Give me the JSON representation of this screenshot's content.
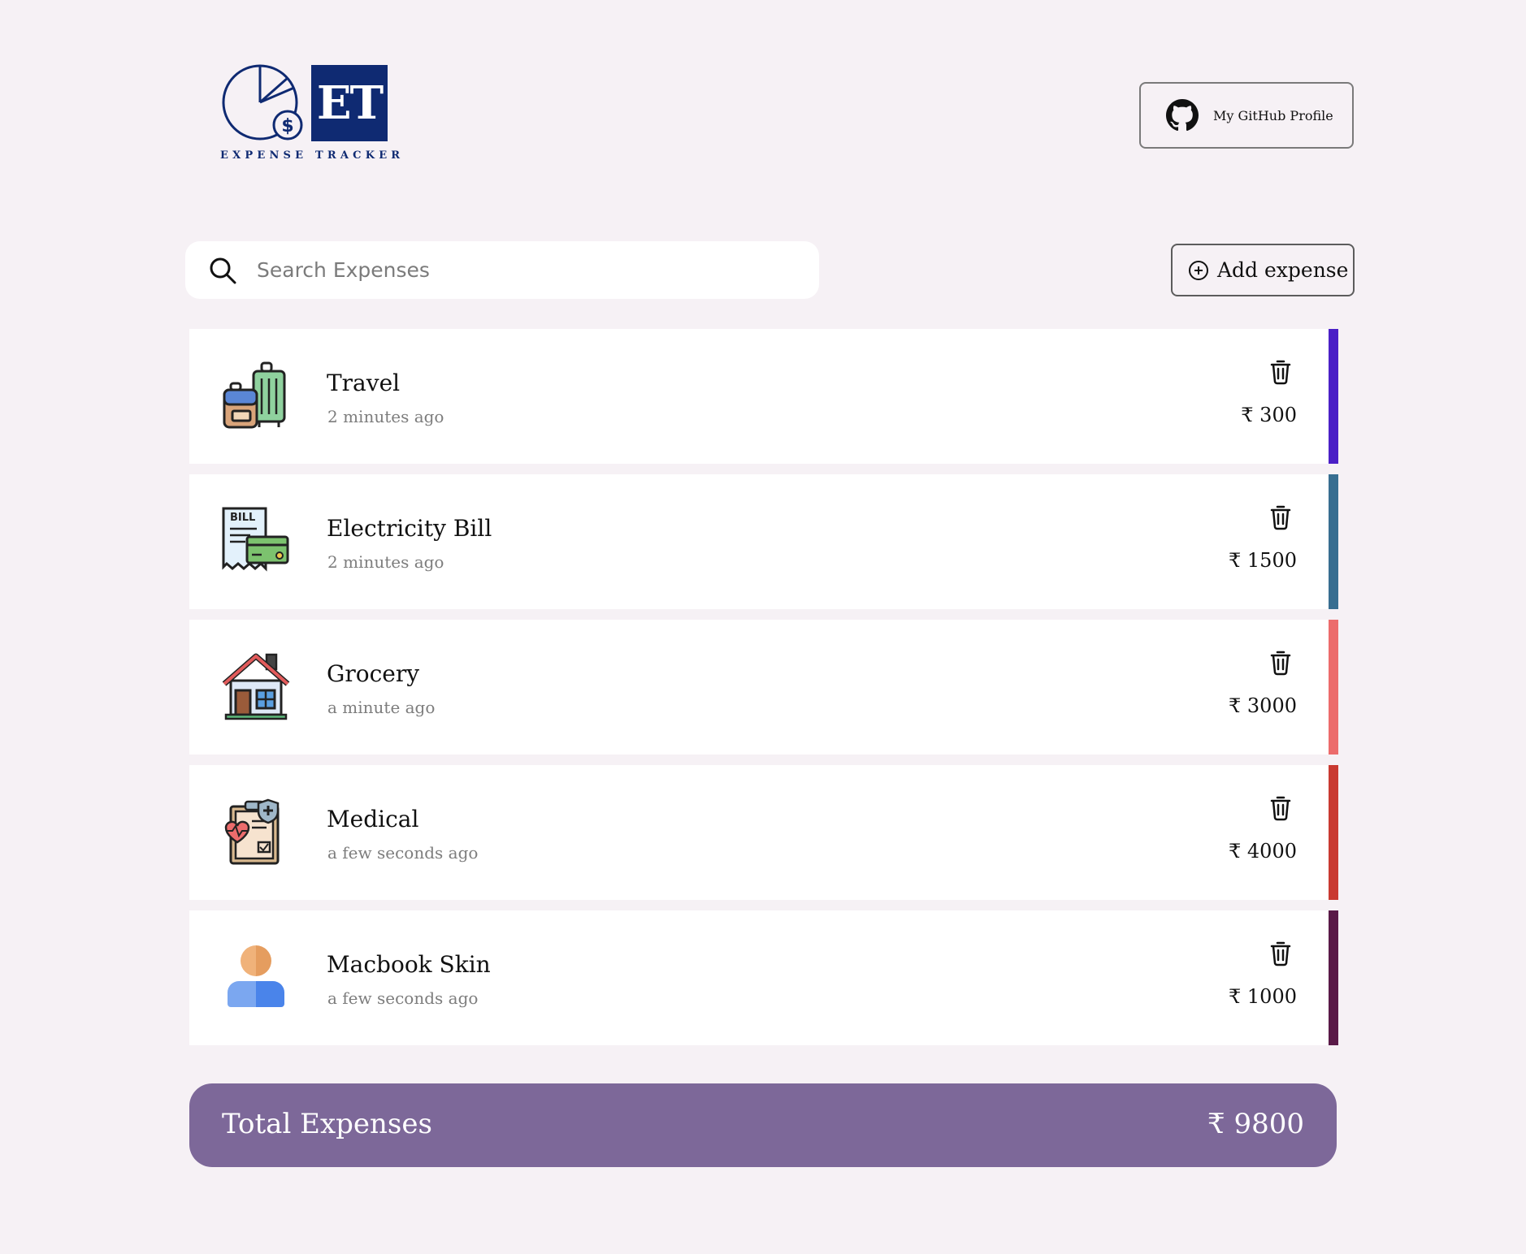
{
  "header": {
    "logo": {
      "monogram": "ET",
      "caption": "EXPENSE TRACKER",
      "brand_color": "#0f2a72"
    },
    "github_button": {
      "label": "My GitHub Profile",
      "icon": "github-icon"
    }
  },
  "toolbar": {
    "search": {
      "placeholder": "Search Expenses",
      "value": "",
      "icon": "search-icon"
    },
    "add_button": {
      "label": "Add expense",
      "icon": "plus-circle-icon"
    }
  },
  "expenses": [
    {
      "title": "Travel",
      "time": "2 minutes ago",
      "amount": "₹ 300",
      "icon": "luggage-icon",
      "accent_color": "#4b20c6"
    },
    {
      "title": "Electricity Bill",
      "time": "2 minutes ago",
      "amount": "₹ 1500",
      "icon": "bill-icon",
      "icon_text": "BILL",
      "accent_color": "#386e91"
    },
    {
      "title": "Grocery",
      "time": "a minute ago",
      "amount": "₹ 3000",
      "icon": "house-icon",
      "accent_color": "#ec6c6c"
    },
    {
      "title": "Medical",
      "time": "a few seconds ago",
      "amount": "₹ 4000",
      "icon": "medical-report-icon",
      "accent_color": "#c93a31"
    },
    {
      "title": "Macbook Skin",
      "time": "a few seconds ago",
      "amount": "₹ 1000",
      "icon": "person-icon",
      "accent_color": "#5a1a48"
    }
  ],
  "delete_icon": "trash-icon",
  "total": {
    "label": "Total Expenses",
    "value": "₹ 9800",
    "background_color": "#7d6899"
  }
}
